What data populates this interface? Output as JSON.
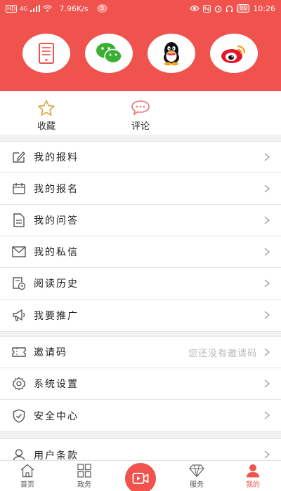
{
  "status_bar": {
    "network": "HD",
    "signal": "4G",
    "speed": "7.96K/s",
    "badge": "5",
    "battery": "90",
    "time": "10:26"
  },
  "share": {
    "icons": [
      "tablet-icon",
      "wechat-icon",
      "qq-icon",
      "weibo-icon"
    ]
  },
  "tabs": [
    {
      "label": "收藏",
      "icon": "star-icon"
    },
    {
      "label": "评论",
      "icon": "comment-icon"
    }
  ],
  "menu_group_1": [
    {
      "label": "我的报料",
      "icon": "edit-note-icon"
    },
    {
      "label": "我的报名",
      "icon": "calendar-icon"
    },
    {
      "label": "我的问答",
      "icon": "document-icon"
    },
    {
      "label": "我的私信",
      "icon": "mail-icon"
    },
    {
      "label": "阅读历史",
      "icon": "history-icon"
    },
    {
      "label": "我要推广",
      "icon": "megaphone-icon"
    }
  ],
  "menu_group_2": [
    {
      "label": "邀请码",
      "icon": "ticket-icon",
      "hint": "您还没有邀请码"
    },
    {
      "label": "系统设置",
      "icon": "gear-icon"
    },
    {
      "label": "安全中心",
      "icon": "shield-icon"
    }
  ],
  "menu_group_3": [
    {
      "label": "用户条款",
      "icon": "user-icon"
    }
  ],
  "bottom_nav": [
    {
      "label": "首页",
      "icon": "home-icon"
    },
    {
      "label": "政务",
      "icon": "grid-icon"
    },
    {
      "label": "服务",
      "icon": "diamond-icon"
    },
    {
      "label": "我的",
      "icon": "profile-icon",
      "active": true
    }
  ],
  "colors": {
    "accent": "#f0524d",
    "divider": "#e6e6e6",
    "hint": "#b8b8b8"
  }
}
